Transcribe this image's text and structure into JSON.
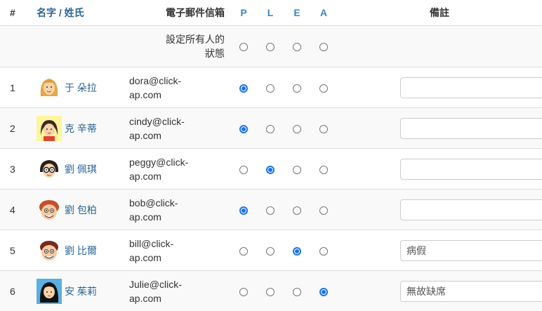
{
  "header": {
    "num": "#",
    "name_first": "名字",
    "name_sep": " / ",
    "name_last": "姓氏",
    "email": "電子郵件信箱",
    "status_cols": [
      "P",
      "L",
      "E",
      "A"
    ],
    "note": "備註"
  },
  "set_all": {
    "label_line1": "設定所有人的",
    "label_line2": "狀態"
  },
  "colors": {
    "link": "#2a6496",
    "status_header": "#3a87c8",
    "radio_checked": "#1a73e8"
  },
  "students": [
    {
      "num": "1",
      "name": "于 朵拉",
      "email_line1": "dora@click-",
      "email_line2": "ap.com",
      "status": "P",
      "note": "",
      "avatar": "blonde-girl-avatar"
    },
    {
      "num": "2",
      "name": "克 辛蒂",
      "email_line1": "cindy@click-",
      "email_line2": "ap.com",
      "status": "P",
      "note": "",
      "avatar": "dark-hair-girl-avatar"
    },
    {
      "num": "3",
      "name": "劉 佩琪",
      "email_line1": "peggy@click-",
      "email_line2": "ap.com",
      "status": "L",
      "note": "",
      "avatar": "glasses-girl-avatar"
    },
    {
      "num": "4",
      "name": "劉 包柏",
      "email_line1": "bob@click-",
      "email_line2": "ap.com",
      "status": "P",
      "note": "",
      "avatar": "redhead-boy-avatar"
    },
    {
      "num": "5",
      "name": "劉 比爾",
      "email_line1": "bill@click-",
      "email_line2": "ap.com",
      "status": "E",
      "note": "病假",
      "avatar": "brown-hair-boy-avatar"
    },
    {
      "num": "6",
      "name": "安 茱莉",
      "email_line1": "Julie@click-",
      "email_line2": "ap.com",
      "status": "A",
      "note": "無故缺席",
      "avatar": "black-hair-girl-avatar"
    }
  ]
}
